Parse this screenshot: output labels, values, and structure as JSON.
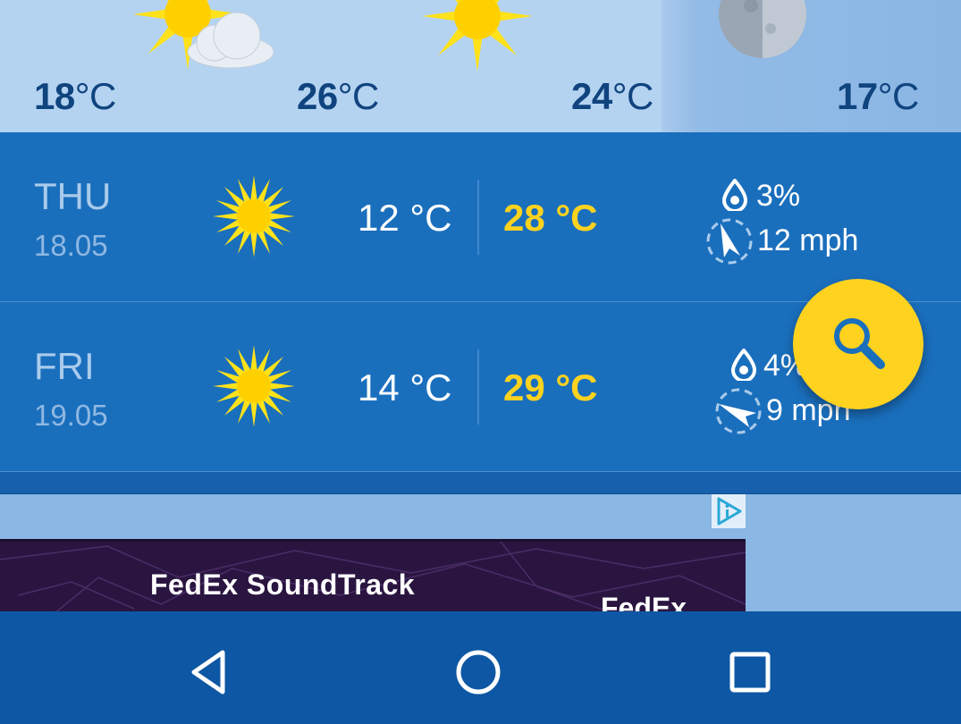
{
  "hourly": {
    "temps": [
      {
        "value": "18",
        "unit": "°C"
      },
      {
        "value": "26",
        "unit": "°C"
      },
      {
        "value": "24",
        "unit": "°C"
      },
      {
        "value": "17",
        "unit": "°C"
      }
    ],
    "icons": [
      "partly-cloudy-icon",
      "sun-icon",
      "moon-icon"
    ]
  },
  "days": [
    {
      "name": "THU",
      "date": "18.05",
      "min": "12 °C",
      "max": "28 °C",
      "precip": "3%",
      "wind": "12 mph",
      "icon": "sun-icon"
    },
    {
      "name": "FRI",
      "date": "19.05",
      "min": "14 °C",
      "max": "29 °C",
      "precip": "4%",
      "wind": "9 mph",
      "icon": "sun-icon"
    }
  ],
  "ad": {
    "title": "FedEx SoundTrack",
    "brand": "FedEx",
    "adchoices_icon": "adchoices-icon"
  },
  "fab": {
    "icon": "search-icon"
  },
  "navbar": {
    "buttons": [
      "back-icon",
      "home-icon",
      "recents-icon"
    ]
  },
  "colors": {
    "accent": "#ffd21f",
    "primary": "#1a6fbd",
    "hourly_bg": "#b4d3f1",
    "navbar": "#0d57a4"
  }
}
